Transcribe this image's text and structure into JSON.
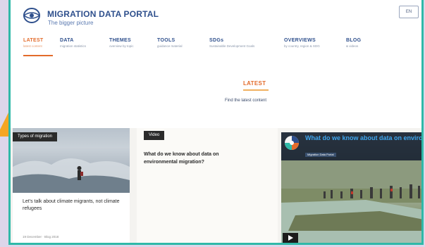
{
  "header": {
    "brand_title": "MIGRATION DATA PORTAL",
    "brand_subtitle": "The bigger picture",
    "language_button": "EN"
  },
  "nav": {
    "items": [
      {
        "label": "LATEST",
        "sub": "latest content"
      },
      {
        "label": "DATA",
        "sub": "migration statistics"
      },
      {
        "label": "THEMES",
        "sub": "overview by topic"
      },
      {
        "label": "TOOLS",
        "sub": "guidance material"
      },
      {
        "label": "SDGs",
        "sub": "Sustainable Development Goals"
      },
      {
        "label": "OVERVIEWS",
        "sub": "by country, region & SDG"
      },
      {
        "label": "BLOG",
        "sub": "& videos"
      }
    ]
  },
  "main": {
    "section_title": "LATEST",
    "section_subtitle": "Find the latest content"
  },
  "cards": [
    {
      "tag": "Types of migration",
      "title": "Let's talk about climate migrants, not climate refugees",
      "date": "19 December · Blog 2018"
    },
    {
      "tag": "Video",
      "title": "What do we know about data on environmental migration?"
    },
    {
      "video_title": "What do we know about data on environmental migration?",
      "video_source": "Migration Data Portal"
    }
  ],
  "colors": {
    "accent_orange": "#e36b2b",
    "brand_blue": "#2e4f8c",
    "frame_teal": "#2fb9a8",
    "video_title_blue": "#3fa6ef"
  }
}
